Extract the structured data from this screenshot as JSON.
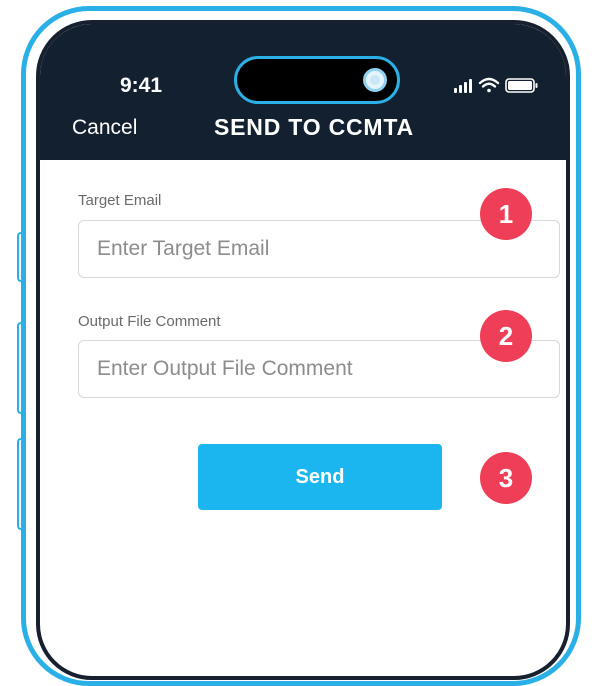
{
  "status_bar": {
    "time": "9:41"
  },
  "nav": {
    "cancel_label": "Cancel",
    "title": "SEND TO CCMTA"
  },
  "form": {
    "target_email": {
      "label": "Target Email",
      "placeholder": "Enter Target Email",
      "value": ""
    },
    "output_comment": {
      "label": "Output File Comment",
      "placeholder": "Enter Output File Comment",
      "value": ""
    },
    "send_label": "Send"
  },
  "annotations": [
    "1",
    "2",
    "3"
  ],
  "colors": {
    "header": "#13202f",
    "frame_accent": "#2ab0e6",
    "button": "#1bb6f0",
    "badge": "#ef3e58"
  },
  "icons": [
    "signal-icon",
    "wifi-icon",
    "battery-icon",
    "camera-icon"
  ]
}
